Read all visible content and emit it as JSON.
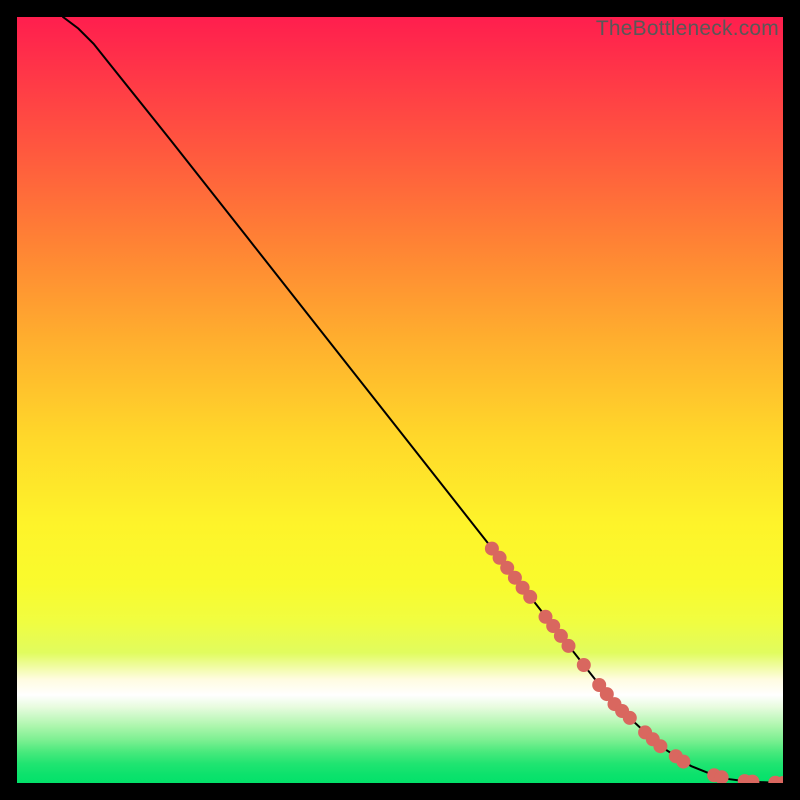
{
  "watermark": "TheBottleneck.com",
  "colors": {
    "point_fill": "#d9675f",
    "line": "#000000"
  },
  "chart_data": {
    "type": "line",
    "title": "",
    "xlabel": "",
    "ylabel": "",
    "xlim": [
      0,
      100
    ],
    "ylim": [
      0,
      100
    ],
    "grid": false,
    "legend": false,
    "series": [
      {
        "name": "curve",
        "kind": "line",
        "x": [
          6,
          8,
          10,
          12,
          20,
          30,
          40,
          50,
          60,
          70,
          78,
          84,
          88,
          91,
          93,
          95,
          96.5,
          98,
          99,
          100
        ],
        "y": [
          100,
          98.5,
          96.5,
          94,
          84,
          71.3,
          58.6,
          45.9,
          33.2,
          20.5,
          10.3,
          4.8,
          2.2,
          1.0,
          0.5,
          0.25,
          0.15,
          0.08,
          0.04,
          0
        ]
      },
      {
        "name": "points",
        "kind": "scatter",
        "x": [
          62,
          63,
          64,
          65,
          66,
          67,
          69,
          70,
          71,
          72,
          74,
          76,
          77,
          78,
          79,
          80,
          82,
          83,
          84,
          86,
          87,
          91,
          92,
          95,
          96,
          99,
          100
        ],
        "y": [
          30.6,
          29.4,
          28.1,
          26.8,
          25.5,
          24.3,
          21.7,
          20.5,
          19.2,
          17.9,
          15.4,
          12.8,
          11.6,
          10.3,
          9.4,
          8.5,
          6.6,
          5.7,
          4.8,
          3.5,
          2.8,
          1.0,
          0.75,
          0.25,
          0.18,
          0.04,
          0.0
        ]
      }
    ]
  }
}
